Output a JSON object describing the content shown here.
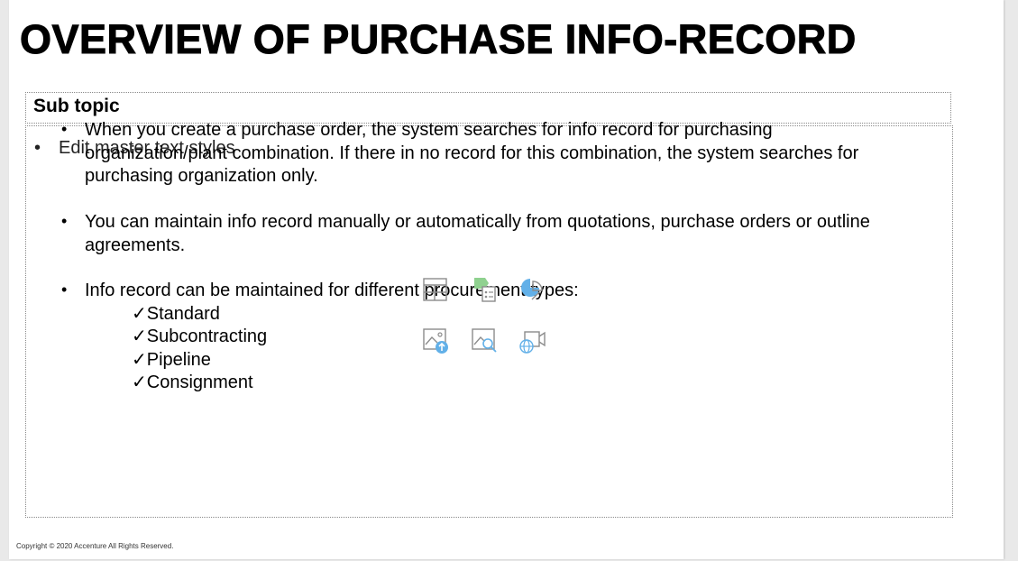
{
  "slide": {
    "title": "OVERVIEW OF PURCHASE INFO-RECORD",
    "subtopic": "Sub topic",
    "placeholder_bullet": "•",
    "placeholder_text": "Edit master text styles",
    "bullet_char": "•",
    "bullets": [
      "When you create a purchase order, the system searches  for info record for purchasing organization/plant combination. If there in no record for this combination, the system searches for purchasing organization only.",
      "You can maintain info record manually or automatically from quotations, purchase orders or outline agreements.",
      "Info record can be maintained for different procurement types:"
    ],
    "sub_items": [
      "✓Standard",
      "✓Subcontracting",
      "✓Pipeline",
      "✓Consignment"
    ],
    "copyright": "Copyright © 2020 Accenture All Rights Reserved."
  },
  "icons": [
    "insert-table-icon",
    "insert-smartart-icon",
    "insert-chart-icon",
    "upload-picture-icon",
    "search-picture-icon",
    "online-video-icon"
  ],
  "colors": {
    "icon_gray": "#8c8c8c",
    "icon_blue": "#62b0e8",
    "icon_green": "#8fd18f"
  }
}
